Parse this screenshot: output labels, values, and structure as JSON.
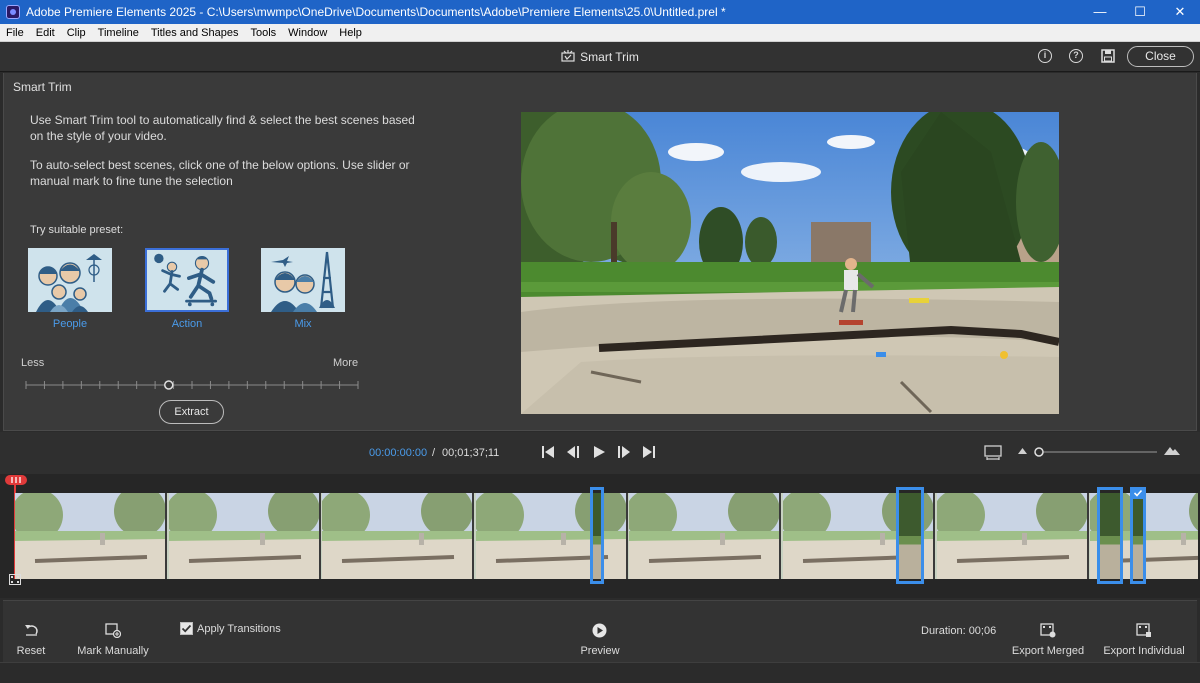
{
  "window": {
    "title": "Adobe Premiere Elements 2025 - C:\\Users\\mwmpc\\OneDrive\\Documents\\Documents\\Adobe\\Premiere Elements\\25.0\\Untitled.prel *",
    "minimize": "—",
    "maximize": "☐",
    "close": "✕"
  },
  "menu": [
    "File",
    "Edit",
    "Clip",
    "Timeline",
    "Titles and Shapes",
    "Tools",
    "Window",
    "Help"
  ],
  "header": {
    "title": "Smart Trim",
    "info_icon": "i",
    "help_icon": "?",
    "close_label": "Close"
  },
  "panel": {
    "title": "Smart Trim",
    "description_1": "Use Smart Trim tool to automatically find & select the best scenes based on the style of your video.",
    "description_2": "To auto-select best scenes, click one of the below options. Use slider or manual mark to fine tune the selection",
    "preset_heading": "Try suitable preset:",
    "presets": [
      {
        "label": "People",
        "selected": false
      },
      {
        "label": "Action",
        "selected": true
      },
      {
        "label": "Mix",
        "selected": false
      }
    ],
    "slider": {
      "min_label": "Less",
      "max_label": "More",
      "value_fraction": 0.43
    },
    "extract_label": "Extract"
  },
  "transport": {
    "current_time": "00:00:00:00",
    "separator": "/",
    "total_time": "00;01;37;11",
    "zoom_fraction": 0.0
  },
  "timeline": {
    "frame_count": 8
  },
  "bottom": {
    "reset_label": "Reset",
    "mark_manually_label": "Mark Manually",
    "apply_transitions_label": "Apply Transitions",
    "apply_transitions_checked": true,
    "preview_label": "Preview",
    "duration_label": "Duration: 00;06",
    "export_merged_label": "Export Merged",
    "export_individual_label": "Export Individual"
  },
  "colors": {
    "accent_blue": "#3b8eea",
    "link_blue": "#4a9bea",
    "playhead_red": "#e03a3a",
    "titlebar": "#1f64c7"
  }
}
